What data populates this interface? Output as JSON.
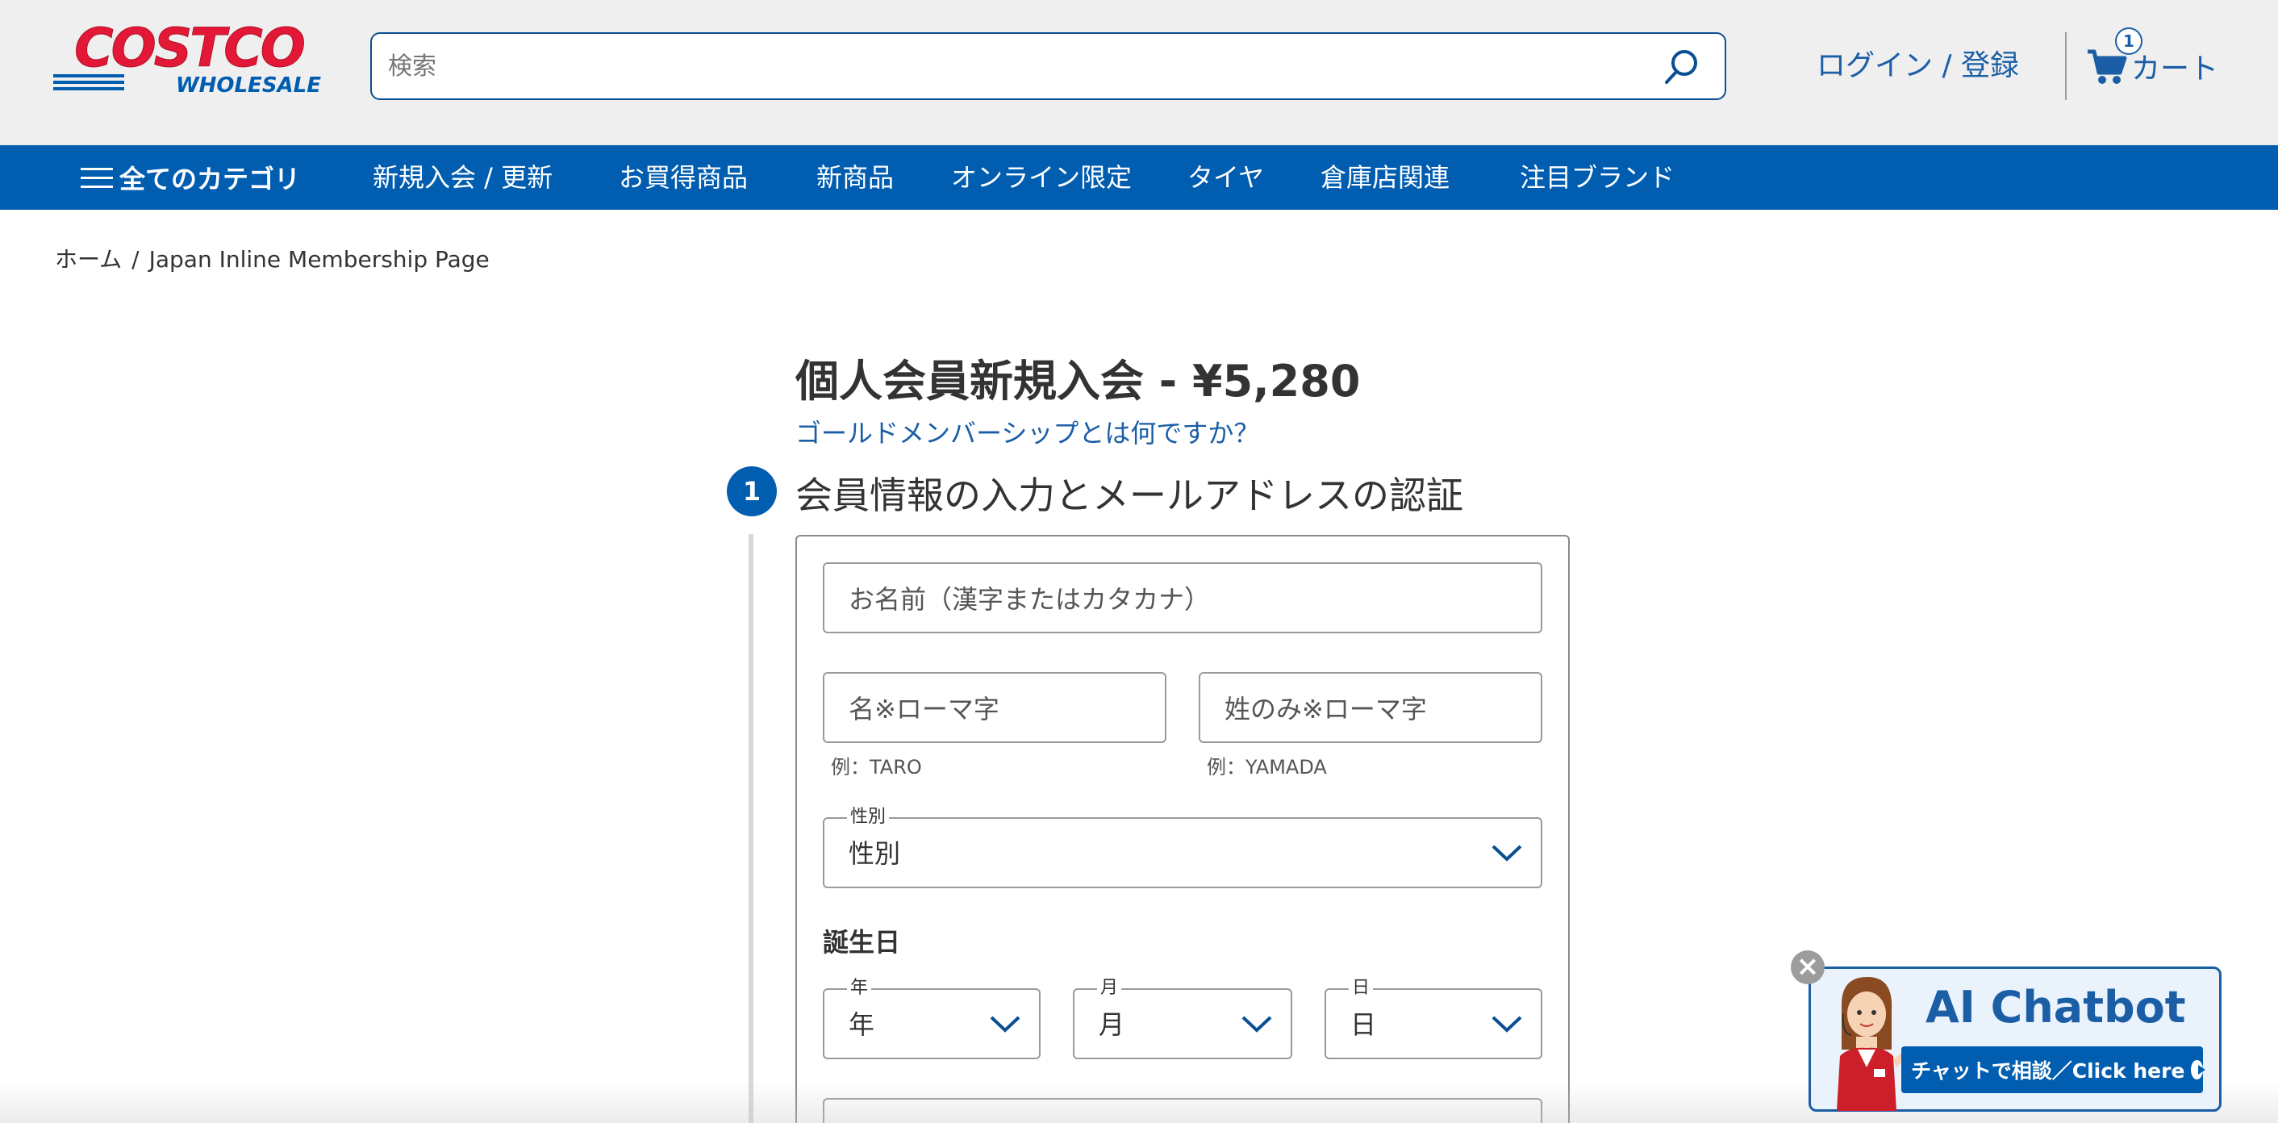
{
  "header": {
    "logo_top": "COSTCO",
    "logo_bottom": "WHOLESALE",
    "search_placeholder": "検索",
    "login_label": "ログイン / 登録",
    "cart_count": "1",
    "cart_label": "カート"
  },
  "nav": {
    "all_categories": "全てのカテゴリ",
    "items": [
      "新規入会 / 更新",
      "お買得商品",
      "新商品",
      "オンライン限定",
      "タイヤ",
      "倉庫店関連",
      "注目ブランド"
    ]
  },
  "breadcrumb": {
    "home": "ホーム",
    "separator": "/",
    "current": "Japan Inline Membership Page"
  },
  "main": {
    "title": "個人会員新規入会 - ¥5,280",
    "gold_link": "ゴールドメンバーシップとは何ですか？",
    "step_number": "1",
    "step_title": "会員情報の入力とメールアドレスの認証"
  },
  "form": {
    "name_kanji_placeholder": "お名前（漢字またはカタカナ）",
    "first_name_placeholder": "名※ローマ字",
    "first_name_helper": "例：TARO",
    "last_name_placeholder": "姓のみ※ローマ字",
    "last_name_helper": "例：YAMADA",
    "gender": {
      "label": "性別",
      "value": "性別"
    },
    "birthday_label": "誕生日",
    "year": {
      "label": "年",
      "value": "年"
    },
    "month": {
      "label": "月",
      "value": "月"
    },
    "day": {
      "label": "日",
      "value": "日"
    }
  },
  "chatbot": {
    "title": "AI Chatbot",
    "cta": "チャットで相談／Click here",
    "close": "×"
  },
  "colors": {
    "brand_blue": "#005db0",
    "brand_red": "#e31837",
    "link_blue": "#1b5ea6",
    "header_bg": "#efefef"
  },
  "icons": {
    "search": "search-icon",
    "cart": "cart-icon",
    "menu": "hamburger-icon",
    "chevron": "chevron-down-icon",
    "close": "close-icon",
    "play": "play-icon"
  }
}
